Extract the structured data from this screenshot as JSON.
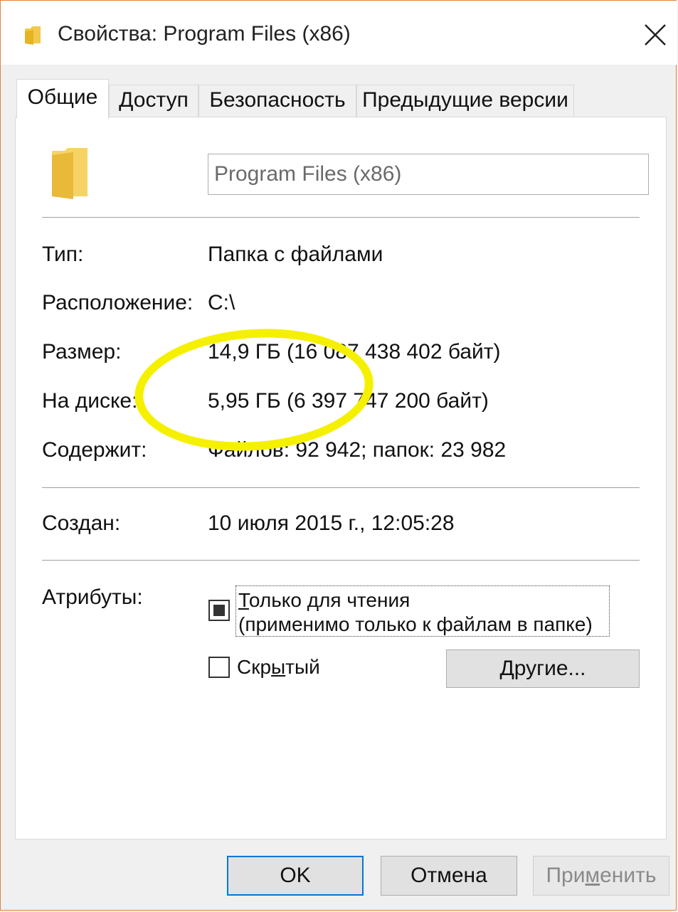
{
  "window": {
    "title": "Свойства: Program Files (x86)",
    "accent_border": "#e8833a"
  },
  "icons": {
    "title": "folder-icon",
    "close": "close-icon",
    "large": "folder-large-icon"
  },
  "tabs": [
    {
      "label": "Общие",
      "active": true
    },
    {
      "label": "Доступ",
      "active": false
    },
    {
      "label": "Безопасность",
      "active": false
    },
    {
      "label": "Предыдущие версии",
      "active": false
    }
  ],
  "general": {
    "folder_name": "Program Files (x86)",
    "rows": [
      {
        "label": "Тип:",
        "value": "Папка с файлами"
      },
      {
        "label": "Расположение:",
        "value": "C:\\"
      },
      {
        "label": "Размер:",
        "value": "14,9 ГБ (16 087 438 402 байт)"
      },
      {
        "label": "На диске:",
        "value": "5,95 ГБ (6 397 747 200 байт)"
      },
      {
        "label": "Содержит:",
        "value": "Файлов: 92 942; папок: 23 982"
      }
    ],
    "created_label": "Создан:",
    "created_value": "10 июля 2015 г., 12:05:28",
    "attributes_label": "Атрибуты:",
    "readonly": {
      "line1_pre": "",
      "line1_key": "Т",
      "line1_post": "олько для чтения",
      "line2": "(применимо только к файлам в папке)",
      "state": "indeterminate"
    },
    "hidden": {
      "pre": "Скр",
      "key": "ы",
      "post": "тый",
      "checked": false
    },
    "other_button": {
      "pre": "",
      "key": "Д",
      "post": "ругие..."
    }
  },
  "buttons": {
    "ok": "OK",
    "cancel": "Отмена",
    "apply_pre": "При",
    "apply_key": "м",
    "apply_post": "енить"
  },
  "annotation": {
    "color": "#f5f000"
  }
}
